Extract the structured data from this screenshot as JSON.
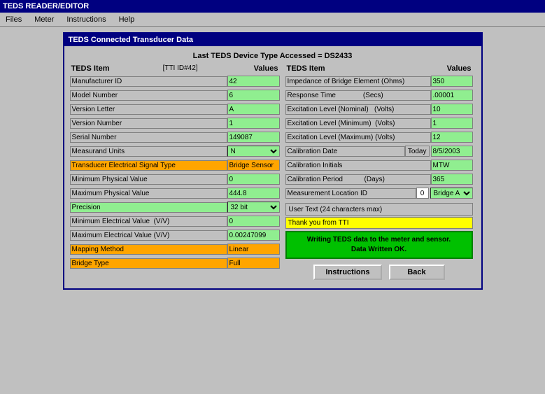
{
  "app": {
    "title": "TEDS READER/EDITOR",
    "menus": [
      "Files",
      "Meter",
      "Instructions",
      "Help"
    ]
  },
  "window": {
    "title": "TEDS Connected Transducer Data",
    "device_info": "Last TEDS Device Type Accessed = DS2433",
    "tti_id": "[TTI ID#42]"
  },
  "left_column": {
    "header_item": "TEDS Item",
    "header_values": "Values",
    "rows": [
      {
        "label": "Manufacturer ID",
        "value": "42",
        "bg": "green"
      },
      {
        "label": "Model Number",
        "value": "6",
        "bg": "green"
      },
      {
        "label": "Version Letter",
        "value": "A",
        "bg": "green"
      },
      {
        "label": "Version Number",
        "value": "1",
        "bg": "green"
      },
      {
        "label": "Serial Number",
        "value": "149087",
        "bg": "green"
      },
      {
        "label": "Measurand Units",
        "value": "N",
        "bg": "green",
        "type": "select"
      },
      {
        "label": "Transducer Electrical Signal Type",
        "value": "Bridge Sensor",
        "bg": "orange",
        "label_bg": "orange"
      },
      {
        "label": "Minimum Physical Value",
        "value": "0",
        "bg": "green"
      },
      {
        "label": "Maximum Physical Value",
        "value": "444.8",
        "bg": "green"
      },
      {
        "label": "Precision",
        "value": "32 bit",
        "bg": "green",
        "label_bg": "green",
        "type": "select"
      },
      {
        "label": "Minimum Electrical Value",
        "suffix": "(V/V)",
        "value": "0",
        "bg": "green"
      },
      {
        "label": "Maximum Electrical Value",
        "suffix": "(V/V)",
        "value": "0.00247099",
        "bg": "green"
      },
      {
        "label": "Mapping Method",
        "value": "Linear",
        "bg": "orange",
        "label_bg": "orange"
      },
      {
        "label": "Bridge Type",
        "value": "Full",
        "bg": "orange",
        "label_bg": "orange"
      }
    ]
  },
  "right_column": {
    "header_item": "TEDS Item",
    "header_values": "Values",
    "rows": [
      {
        "label": "Impedance of Bridge Element (Ohms)",
        "value": "350",
        "bg": "green"
      },
      {
        "label": "Response Time",
        "suffix": "(Secs)",
        "value": ".00001",
        "bg": "green"
      },
      {
        "label": "Excitation Level (Nominal)",
        "suffix": "(Volts)",
        "value": "10",
        "bg": "green"
      },
      {
        "label": "Excitation Level (Minimum)",
        "suffix": "(Volts)",
        "value": "1",
        "bg": "green"
      },
      {
        "label": "Excitation Level (Maximum)",
        "suffix": "(Volts)",
        "value": "12",
        "bg": "green"
      },
      {
        "label": "Calibration Date",
        "today": "Today",
        "value": "8/5/2003",
        "bg": "green"
      },
      {
        "label": "Calibration Initials",
        "value": "MTW",
        "bg": "green"
      },
      {
        "label": "Calibration Period",
        "suffix": "(Days)",
        "value": "365",
        "bg": "green"
      },
      {
        "label": "Measurement Location ID",
        "num": "0",
        "select_value": "Bridge A",
        "bg": "green"
      }
    ],
    "user_text_label": "User Text (24 characters max)",
    "user_text_value": "Thank you from TTI",
    "status_message_line1": "Writing TEDS data to the meter and sensor.",
    "status_message_line2": "Data Written OK.",
    "buttons": {
      "instructions": "Instructions",
      "back": "Back"
    }
  }
}
